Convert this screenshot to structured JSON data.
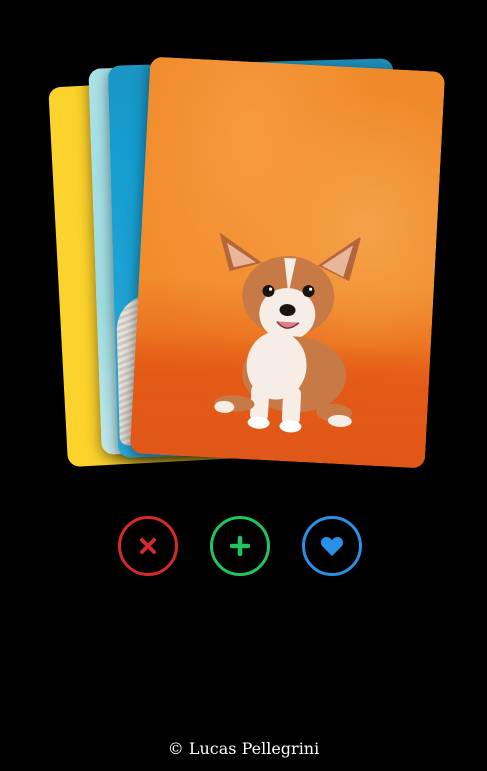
{
  "cards": [
    {
      "name": "yellow",
      "color": "#fcd22c"
    },
    {
      "name": "light-blue",
      "color": "#a9e2e8"
    },
    {
      "name": "blue",
      "color": "#1f8db9"
    },
    {
      "name": "corgi-orange",
      "color": "#ef8a2a"
    }
  ],
  "actions": {
    "dislike": {
      "icon": "close-icon",
      "color": "#d42a2a"
    },
    "add": {
      "icon": "plus-icon",
      "color": "#22c361"
    },
    "like": {
      "icon": "heart-icon",
      "color": "#2a8fe6"
    }
  },
  "footer": {
    "text": "© Lucas Pellegrini"
  }
}
